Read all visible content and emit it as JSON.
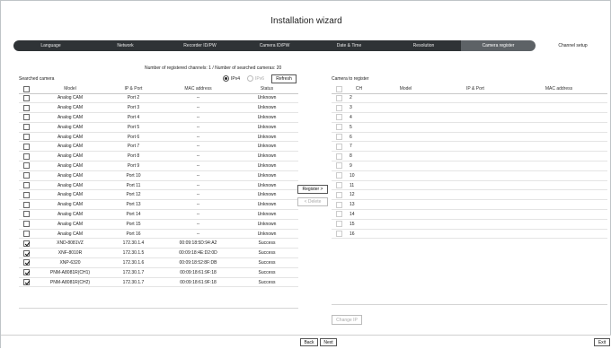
{
  "header": {
    "title": "Installation wizard"
  },
  "steps": [
    {
      "label": "Language"
    },
    {
      "label": "Network"
    },
    {
      "label": "Recorder ID/PW"
    },
    {
      "label": "Camera ID/PW"
    },
    {
      "label": "Date & Time"
    },
    {
      "label": "Resolution"
    },
    {
      "label": "Camera register"
    },
    {
      "label": "Channel setup"
    }
  ],
  "summary": {
    "text": "Number of registered channels: 1 / Number of searched cameras: 20"
  },
  "searched": {
    "label": "Searched camera",
    "ipv4": "IPv4",
    "ipv6": "IPv6",
    "refresh": "Refresh",
    "columns": {
      "model": "Model",
      "ip": "IP & Port",
      "mac": "MAC address",
      "status": "Status"
    },
    "rows": [
      {
        "model": "Analog CAM",
        "ip": "Port 2",
        "mac": "--",
        "status": "Unknown",
        "checked": false
      },
      {
        "model": "Analog CAM",
        "ip": "Port 3",
        "mac": "--",
        "status": "Unknown",
        "checked": false
      },
      {
        "model": "Analog CAM",
        "ip": "Port 4",
        "mac": "--",
        "status": "Unknown",
        "checked": false
      },
      {
        "model": "Analog CAM",
        "ip": "Port 5",
        "mac": "--",
        "status": "Unknown",
        "checked": false
      },
      {
        "model": "Analog CAM",
        "ip": "Port 6",
        "mac": "--",
        "status": "Unknown",
        "checked": false
      },
      {
        "model": "Analog CAM",
        "ip": "Port 7",
        "mac": "--",
        "status": "Unknown",
        "checked": false
      },
      {
        "model": "Analog CAM",
        "ip": "Port 8",
        "mac": "--",
        "status": "Unknown",
        "checked": false
      },
      {
        "model": "Analog CAM",
        "ip": "Port 9",
        "mac": "--",
        "status": "Unknown",
        "checked": false
      },
      {
        "model": "Analog CAM",
        "ip": "Port 10",
        "mac": "--",
        "status": "Unknown",
        "checked": false
      },
      {
        "model": "Analog CAM",
        "ip": "Port 11",
        "mac": "--",
        "status": "Unknown",
        "checked": false
      },
      {
        "model": "Analog CAM",
        "ip": "Port 12",
        "mac": "--",
        "status": "Unknown",
        "checked": false
      },
      {
        "model": "Analog CAM",
        "ip": "Port 13",
        "mac": "--",
        "status": "Unknown",
        "checked": false
      },
      {
        "model": "Analog CAM",
        "ip": "Port 14",
        "mac": "--",
        "status": "Unknown",
        "checked": false
      },
      {
        "model": "Analog CAM",
        "ip": "Port 15",
        "mac": "--",
        "status": "Unknown",
        "checked": false
      },
      {
        "model": "Analog CAM",
        "ip": "Port 16",
        "mac": "--",
        "status": "Unknown",
        "checked": false
      },
      {
        "model": "XND-8081VZ",
        "ip": "172.30.1.4",
        "mac": "00:09:18:5D:94:A2",
        "status": "Success",
        "checked": true
      },
      {
        "model": "XNF-8010R",
        "ip": "172.30.1.5",
        "mac": "00:09:18:4E:D2:0D",
        "status": "Success",
        "checked": true
      },
      {
        "model": "XNP-6320",
        "ip": "172.30.1.6",
        "mac": "00:09:18:52:8F:DB",
        "status": "Success",
        "checked": true
      },
      {
        "model": "PNM-A8081R(CH1)",
        "ip": "172.30.1.7",
        "mac": "00:09:18:61:9F:18",
        "status": "Success",
        "checked": true
      },
      {
        "model": "PNM-A8081R(CH2)",
        "ip": "172.30.1.7",
        "mac": "00:09:18:61:9F:18",
        "status": "Success",
        "checked": true
      }
    ]
  },
  "actions": {
    "register": "Register >",
    "delete": "< Delete"
  },
  "register_panel": {
    "label": "Camera to register",
    "columns": {
      "ch": "CH",
      "model": "Model",
      "ip": "IP & Port",
      "mac": "MAC address"
    },
    "rows": [
      {
        "ch": "2"
      },
      {
        "ch": "3"
      },
      {
        "ch": "4"
      },
      {
        "ch": "5"
      },
      {
        "ch": "6"
      },
      {
        "ch": "7"
      },
      {
        "ch": "8"
      },
      {
        "ch": "9"
      },
      {
        "ch": "10"
      },
      {
        "ch": "11"
      },
      {
        "ch": "12"
      },
      {
        "ch": "13"
      },
      {
        "ch": "14"
      },
      {
        "ch": "15"
      },
      {
        "ch": "16"
      }
    ],
    "change_ip": "Change IP"
  },
  "footer": {
    "back": "Back",
    "next": "Next",
    "exit": "Exit"
  }
}
